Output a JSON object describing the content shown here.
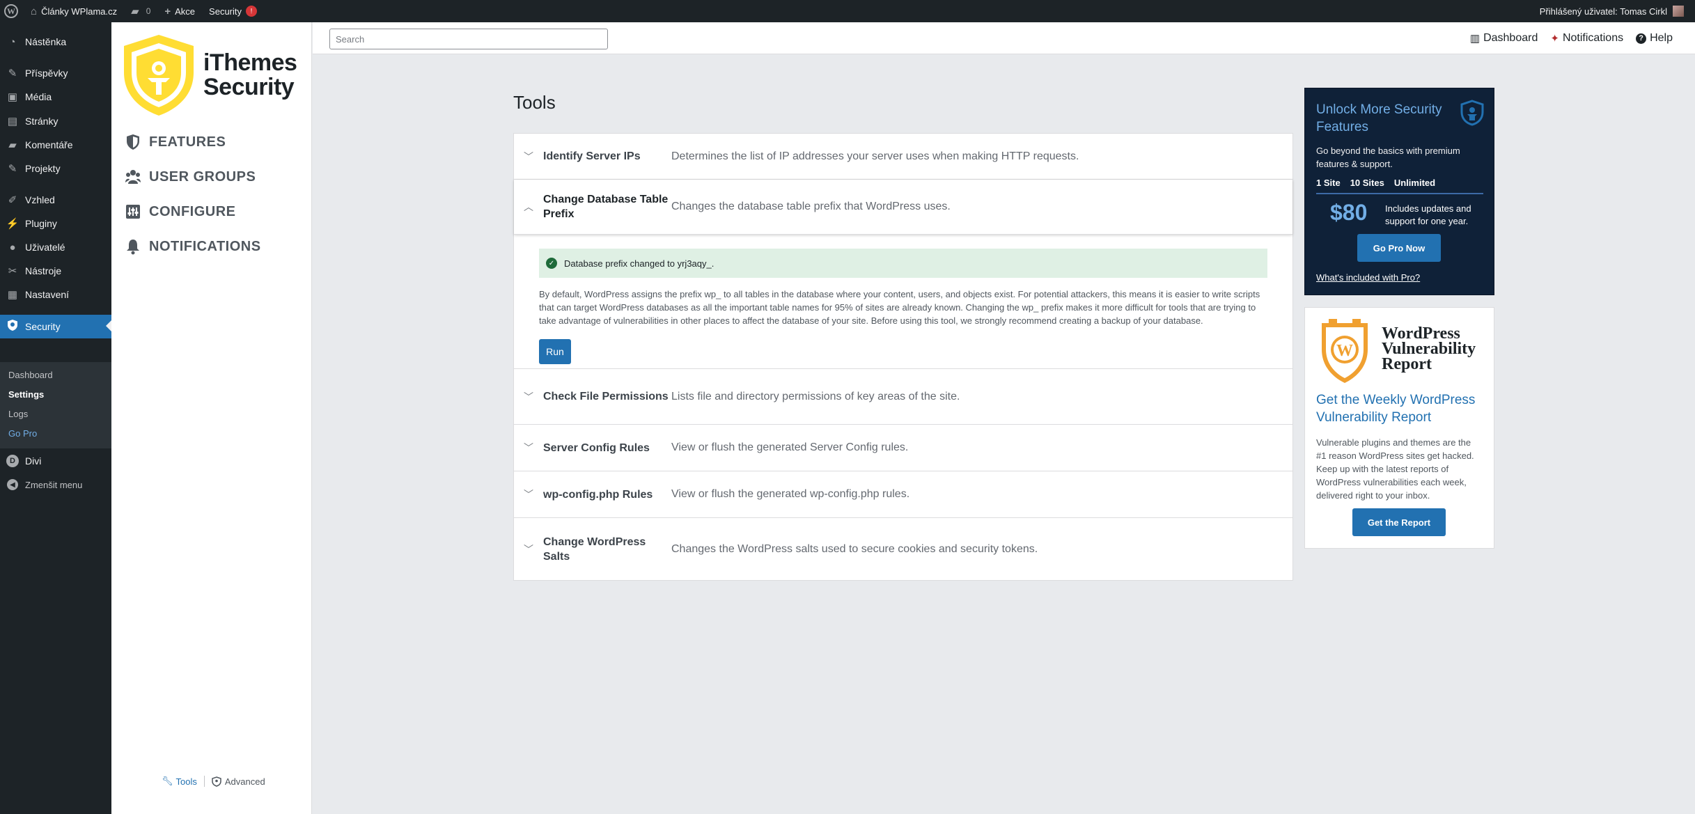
{
  "admin_bar": {
    "site_name": "Články WPlama.cz",
    "comments_count": "0",
    "new_label": "Akce",
    "security_label": "Security",
    "security_badge": "!",
    "greeting": "Přihlášený uživatel: Tomas Cirkl"
  },
  "admin_menu": {
    "items": [
      {
        "label": "Nástěnka",
        "icon": "dashboard-icon"
      },
      {
        "label": "Příspěvky",
        "icon": "pin-icon"
      },
      {
        "label": "Média",
        "icon": "media-icon"
      },
      {
        "label": "Stránky",
        "icon": "page-icon"
      },
      {
        "label": "Komentáře",
        "icon": "comment-icon"
      },
      {
        "label": "Projekty",
        "icon": "pin-icon"
      },
      {
        "label": "Vzhled",
        "icon": "brush-icon"
      },
      {
        "label": "Pluginy",
        "icon": "plug-icon"
      },
      {
        "label": "Uživatelé",
        "icon": "user-icon"
      },
      {
        "label": "Nástroje",
        "icon": "wrench-icon"
      },
      {
        "label": "Nastavení",
        "icon": "settings-icon"
      },
      {
        "label": "Security",
        "icon": "shield-icon"
      },
      {
        "label": "Divi",
        "icon": "divi-icon"
      },
      {
        "label": "Zmenšit menu",
        "icon": "collapse-icon"
      }
    ],
    "submenu": [
      {
        "label": "Dashboard"
      },
      {
        "label": "Settings"
      },
      {
        "label": "Logs"
      },
      {
        "label": "Go Pro"
      }
    ]
  },
  "itsec_nav": {
    "brand_line1": "iThemes",
    "brand_line2": "Security",
    "items": [
      {
        "label": "FEATURES",
        "icon": "shield-icon"
      },
      {
        "label": "USER GROUPS",
        "icon": "users-icon"
      },
      {
        "label": "CONFIGURE",
        "icon": "configure-icon"
      },
      {
        "label": "NOTIFICATIONS",
        "icon": "bell-icon"
      }
    ],
    "footer_tools": "Tools",
    "footer_advanced": "Advanced"
  },
  "topbar": {
    "search_placeholder": "Search",
    "links": [
      {
        "label": "Dashboard",
        "icon": "dashboard-icon"
      },
      {
        "label": "Notifications",
        "icon": "notifications-icon"
      },
      {
        "label": "Help",
        "icon": "help-icon"
      }
    ]
  },
  "main": {
    "title": "Tools",
    "tools": [
      {
        "name": "Identify Server IPs",
        "desc": "Determines the list of IP addresses your server uses when making HTTP requests."
      },
      {
        "name": "Change Database Table Prefix",
        "desc": "Changes the database table prefix that WordPress uses."
      },
      {
        "name": "Check File Permissions",
        "desc": "Lists file and directory permissions of key areas of the site."
      },
      {
        "name": "Server Config Rules",
        "desc": "View or flush the generated Server Config rules."
      },
      {
        "name": "wp-config.php Rules",
        "desc": "View or flush the generated wp-config.php rules."
      },
      {
        "name": "Change WordPress Salts",
        "desc": "Changes the WordPress salts used to secure cookies and security tokens."
      }
    ],
    "expanded": {
      "notice": "Database prefix changed to yrj3aqy_.",
      "text": "By default, WordPress assigns the prefix wp_ to all tables in the database where your content, users, and objects exist. For potential attackers, this means it is easier to write scripts that can target WordPress databases as all the important table names for 95% of sites are already known. Changing the wp_ prefix makes it more difficult for tools that are trying to take advantage of vulnerabilities in other places to affect the database of your site. Before using this tool, we strongly recommend creating a backup of your database.",
      "run_label": "Run"
    }
  },
  "promo": {
    "title": "Unlock More Security Features",
    "desc": "Go beyond the basics with premium features & support.",
    "tabs": [
      "1 Site",
      "10 Sites",
      "Unlimited"
    ],
    "price": "$80",
    "includes": "Includes updates and support for one year.",
    "button": "Go Pro Now",
    "link": "What's included with Pro?"
  },
  "vuln": {
    "title": "WordPress Vulnerability Report",
    "heading": "Get the Weekly WordPress Vulnerability Report",
    "desc": "Vulnerable plugins and themes are the #1 reason WordPress sites get hacked. Keep up with the latest reports of WordPress vulnerabilities each week, delivered right to your inbox.",
    "button": "Get the Report"
  },
  "colors": {
    "admin_dark": "#1d2327",
    "wp_blue": "#2271b1",
    "brand_yellow": "#ffdd33",
    "promo_navy": "#0f2138",
    "success_bg": "#dff0e4"
  }
}
